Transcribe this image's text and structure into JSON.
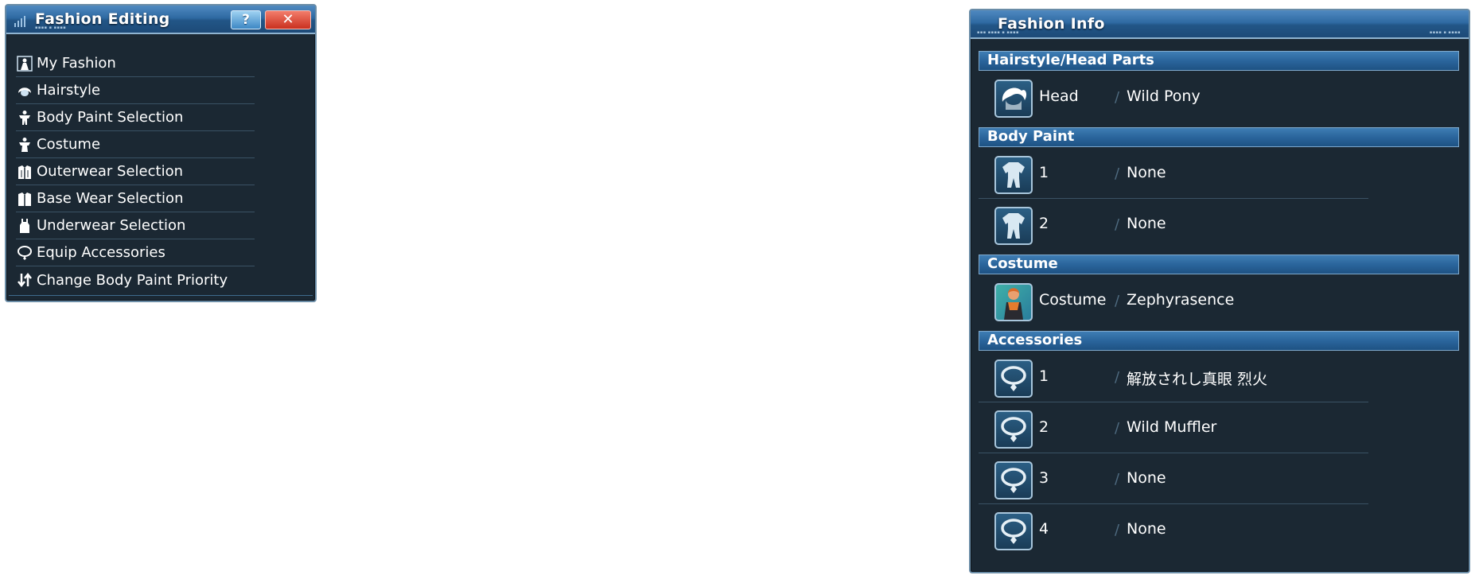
{
  "editing": {
    "title": "Fashion Editing",
    "help_label": "?",
    "close_label": "✕",
    "menu": [
      {
        "label": "My Fashion",
        "icon": "my-fashion-icon"
      },
      {
        "label": "Hairstyle",
        "icon": "hairstyle-icon"
      },
      {
        "label": "Body Paint Selection",
        "icon": "body-paint-icon"
      },
      {
        "label": "Costume",
        "icon": "costume-icon"
      },
      {
        "label": "Outerwear Selection",
        "icon": "outerwear-icon"
      },
      {
        "label": "Base Wear Selection",
        "icon": "base-wear-icon"
      },
      {
        "label": "Underwear Selection",
        "icon": "underwear-icon"
      },
      {
        "label": "Equip Accessories",
        "icon": "accessory-icon"
      },
      {
        "label": "Change Body Paint Priority",
        "icon": "priority-arrows-icon"
      }
    ]
  },
  "info": {
    "title": "Fashion Info",
    "sections": {
      "hair": {
        "heading": "Hairstyle/Head Parts",
        "items": [
          {
            "label": "Head",
            "value": "Wild Pony",
            "icon": "hair-icon"
          }
        ]
      },
      "paint": {
        "heading": "Body Paint",
        "items": [
          {
            "label": "1",
            "value": "None",
            "icon": "body-suit-icon"
          },
          {
            "label": "2",
            "value": "None",
            "icon": "body-suit-icon"
          }
        ]
      },
      "costume": {
        "heading": "Costume",
        "items": [
          {
            "label": "Costume",
            "value": "Zephyrasence",
            "icon": "costume-portrait-icon"
          }
        ]
      },
      "accessories": {
        "heading": "Accessories",
        "items": [
          {
            "label": "1",
            "value": "解放されし真眼 烈火",
            "icon": "accessory-necklace-icon"
          },
          {
            "label": "2",
            "value": "Wild Muffler",
            "icon": "accessory-necklace-icon"
          },
          {
            "label": "3",
            "value": "None",
            "icon": "accessory-necklace-icon"
          },
          {
            "label": "4",
            "value": "None",
            "icon": "accessory-necklace-icon"
          }
        ]
      }
    }
  },
  "colors": {
    "panel_bg": "#1b2833",
    "titlebar_blue": "#2f6aa3",
    "section_blue": "#2a659c",
    "close_red": "#d9402e",
    "help_blue": "#5fa8dc",
    "text": "#ffffff"
  }
}
